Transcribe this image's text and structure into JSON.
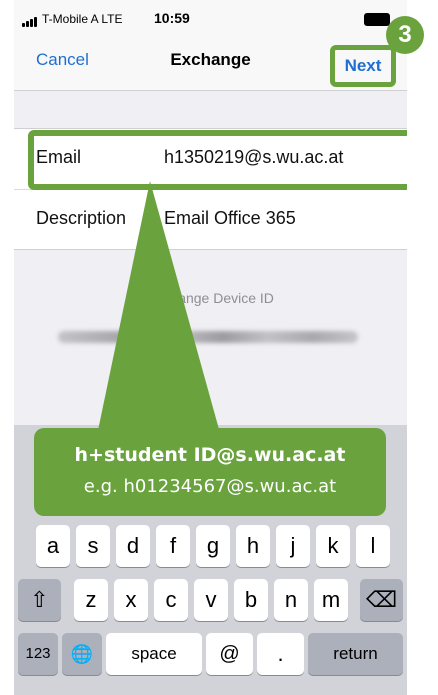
{
  "status_bar": {
    "carrier": "T-Mobile A  LTE",
    "time": "10:59"
  },
  "nav": {
    "cancel": "Cancel",
    "title": "Exchange",
    "next": "Next"
  },
  "step_number": "3",
  "form": {
    "email_label": "Email",
    "email_value": "h1350219@s.wu.ac.at",
    "description_label": "Description",
    "description_value": "Email Office 365"
  },
  "section": {
    "device_id_label": "Exchange Device ID"
  },
  "callout": {
    "line1": "h+student ID@s.wu.ac.at",
    "line2": "e.g. h01234567@s.wu.ac.at"
  },
  "keyboard": {
    "row2": [
      "a",
      "s",
      "d",
      "f",
      "g",
      "h",
      "j",
      "k",
      "l"
    ],
    "row3": [
      "z",
      "x",
      "c",
      "v",
      "b",
      "n",
      "m"
    ],
    "shift": "⇧",
    "backspace": "⌫",
    "numbers": "123",
    "globe": "🌐",
    "space": "space",
    "at": "@",
    "dot": ".",
    "return": "return"
  },
  "colors": {
    "accent_green": "#6aa33d",
    "ios_blue": "#1f6fd1"
  }
}
